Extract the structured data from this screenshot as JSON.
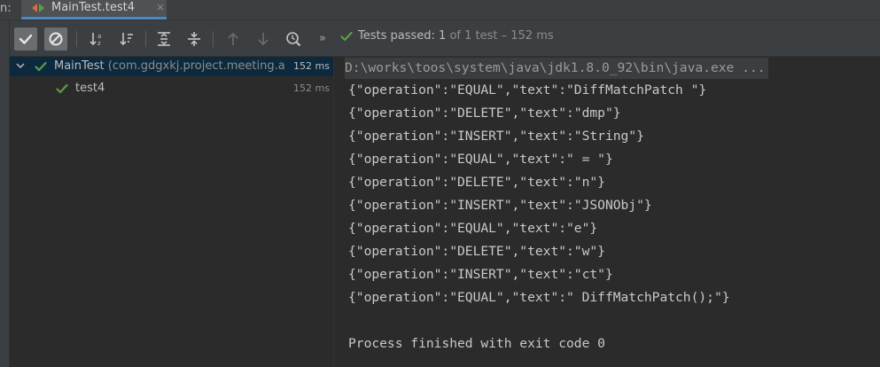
{
  "tabbar": {
    "run_label": "n:",
    "tab_title": "MainTest.test4",
    "tab_close": "×"
  },
  "toolbar": {
    "more": "»",
    "status_main": "Tests passed: ",
    "status_count": "1",
    "status_tail": " of 1 test – 152 ms"
  },
  "tree": {
    "root": {
      "name": "MainTest",
      "package": "(com.gdgxkj.project.meeting.a",
      "time": "152 ms"
    },
    "child": {
      "name": "test4",
      "time": "152 ms"
    }
  },
  "console": {
    "command": "D:\\works\\toos\\system\\java\\jdk1.8.0_92\\bin\\java.exe ...",
    "lines": [
      "{\"operation\":\"EQUAL\",\"text\":\"DiffMatchPatch \"}",
      "{\"operation\":\"DELETE\",\"text\":\"dmp\"}",
      "{\"operation\":\"INSERT\",\"text\":\"String\"}",
      "{\"operation\":\"EQUAL\",\"text\":\" = \"}",
      "{\"operation\":\"DELETE\",\"text\":\"n\"}",
      "{\"operation\":\"INSERT\",\"text\":\"JSONObj\"}",
      "{\"operation\":\"EQUAL\",\"text\":\"e\"}",
      "{\"operation\":\"DELETE\",\"text\":\"w\"}",
      "{\"operation\":\"INSERT\",\"text\":\"ct\"}",
      "{\"operation\":\"EQUAL\",\"text\":\" DiffMatchPatch();\"}",
      "",
      "Process finished with exit code 0"
    ]
  },
  "colors": {
    "success": "#5e9c4a",
    "selection": "#0d293e",
    "tab_underline": "#4a88c7"
  }
}
